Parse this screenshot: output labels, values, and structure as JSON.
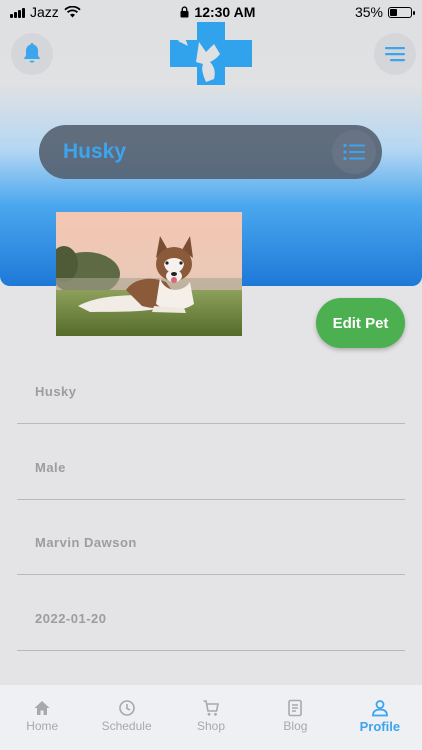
{
  "status_bar": {
    "carrier": "Jazz",
    "time": "12:30 AM",
    "battery": "35%",
    "battery_level": 0.35
  },
  "header": {
    "bell_icon": "bell-icon",
    "menu_icon": "menu-icon",
    "logo": "pet-clinic-logo"
  },
  "pet_header": {
    "name": "Husky",
    "list_icon": "list-icon"
  },
  "photo": {
    "subject": "husky-dog-photo"
  },
  "actions": {
    "edit_label": "Edit Pet"
  },
  "fields": [
    {
      "value": "Husky"
    },
    {
      "value": "Male"
    },
    {
      "value": "Marvin Dawson"
    },
    {
      "value": "2022-01-20"
    }
  ],
  "nav": [
    {
      "label": "Home",
      "icon": "home-icon"
    },
    {
      "label": "Schedule",
      "icon": "clock-icon"
    },
    {
      "label": "Shop",
      "icon": "cart-icon"
    },
    {
      "label": "Blog",
      "icon": "document-icon"
    },
    {
      "label": "Profile",
      "icon": "person-icon",
      "active": true
    }
  ],
  "colors": {
    "accent": "#3da4ee",
    "edit": "#4caf50",
    "gradient_bottom": "#1d79d7"
  }
}
